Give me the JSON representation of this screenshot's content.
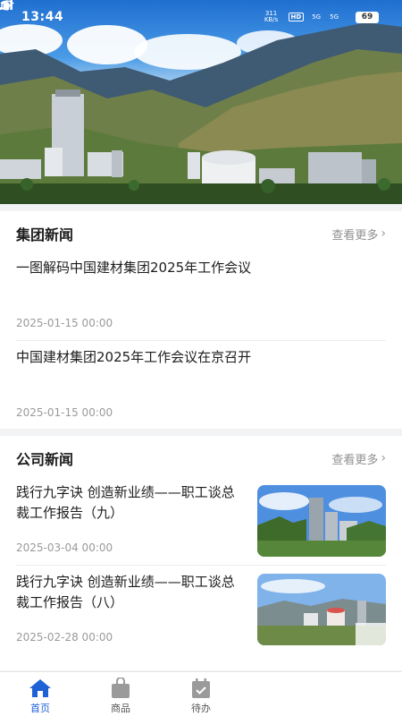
{
  "status_bar": {
    "time": "13:44",
    "net_speed": "311 KB/s",
    "hd_label": "HD",
    "signal1_label": "5G",
    "signal2_label": "5G",
    "battery": "69"
  },
  "group_news": {
    "title": "集团新闻",
    "more_label": "查看更多",
    "items": [
      {
        "title": "一图解码中国建材集团2025年工作会议",
        "date": "2025-01-15 00:00"
      },
      {
        "title": "中国建材集团2025年工作会议在京召开",
        "date": "2025-01-15 00:00"
      }
    ]
  },
  "company_news": {
    "title": "公司新闻",
    "more_label": "查看更多",
    "items": [
      {
        "title": "践行九字诀 创造新业绩——职工谈总裁工作报告（九）",
        "date": "2025-03-04 00:00"
      },
      {
        "title": "践行九字诀 创造新业绩——职工谈总裁工作报告（八）",
        "date": "2025-02-28 00:00"
      }
    ]
  },
  "tabbar": {
    "tabs": [
      {
        "label": "首页",
        "icon": "home-icon",
        "active": true
      },
      {
        "label": "商品",
        "icon": "bag-icon",
        "active": false
      },
      {
        "label": "待办",
        "icon": "calendar-check-icon",
        "active": false
      }
    ]
  },
  "colors": {
    "accent": "#1f62d6",
    "muted": "#9a9a9a"
  }
}
